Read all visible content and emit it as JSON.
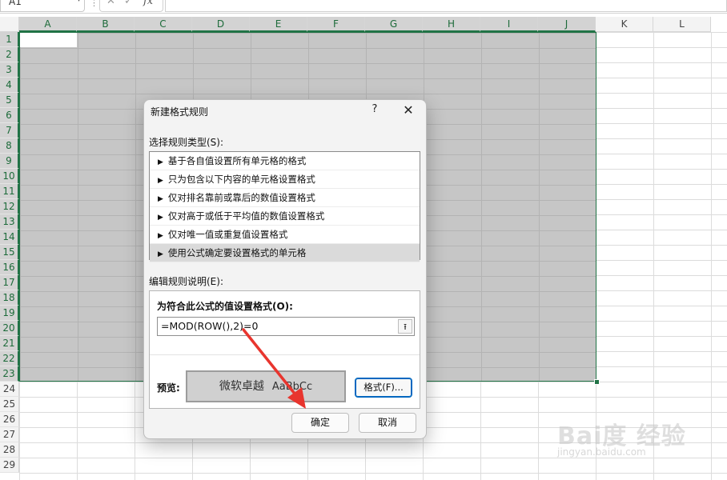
{
  "name_box": {
    "value": "A1"
  },
  "formula_bar": {
    "fx_label": "fx",
    "cancel_glyph": "✕",
    "enter_glyph": "✓"
  },
  "columns": [
    "A",
    "B",
    "C",
    "D",
    "E",
    "F",
    "G",
    "H",
    "I",
    "J",
    "K",
    "L"
  ],
  "rows": [
    "1",
    "2",
    "3",
    "4",
    "5",
    "6",
    "7",
    "8",
    "9",
    "10",
    "11",
    "12",
    "13",
    "14",
    "15",
    "16",
    "17",
    "18",
    "19",
    "20",
    "21",
    "22",
    "23",
    "24",
    "25",
    "26",
    "27",
    "28",
    "29"
  ],
  "selection": {
    "range": "A1:J23"
  },
  "dialog": {
    "title": "新建格式规则",
    "help_glyph": "?",
    "close_glyph": "✕",
    "rule_type_label": "选择规则类型(S):",
    "rule_types": [
      "基于各自值设置所有单元格的格式",
      "只为包含以下内容的单元格设置格式",
      "仅对排名靠前或靠后的数值设置格式",
      "仅对高于或低于平均值的数值设置格式",
      "仅对唯一值或重复值设置格式",
      "使用公式确定要设置格式的单元格"
    ],
    "selected_rule_index": 5,
    "description_label": "编辑规则说明(E):",
    "formula_label": "为符合此公式的值设置格式(O):",
    "formula_value": "=MOD(ROW(),2)=0",
    "preview_label": "预览:",
    "preview_text_cn": "微软卓越",
    "preview_text_en": "AaBbCc",
    "format_button": "格式(F)...",
    "ok_button": "确定",
    "cancel_button": "取消"
  },
  "watermark": {
    "logo_text": "Bai度 经验",
    "url": "jingyan.baidu.com"
  },
  "colors": {
    "selection_border": "#217346",
    "annotation_arrow": "#e8352e",
    "format_button_border": "#0067c0"
  }
}
